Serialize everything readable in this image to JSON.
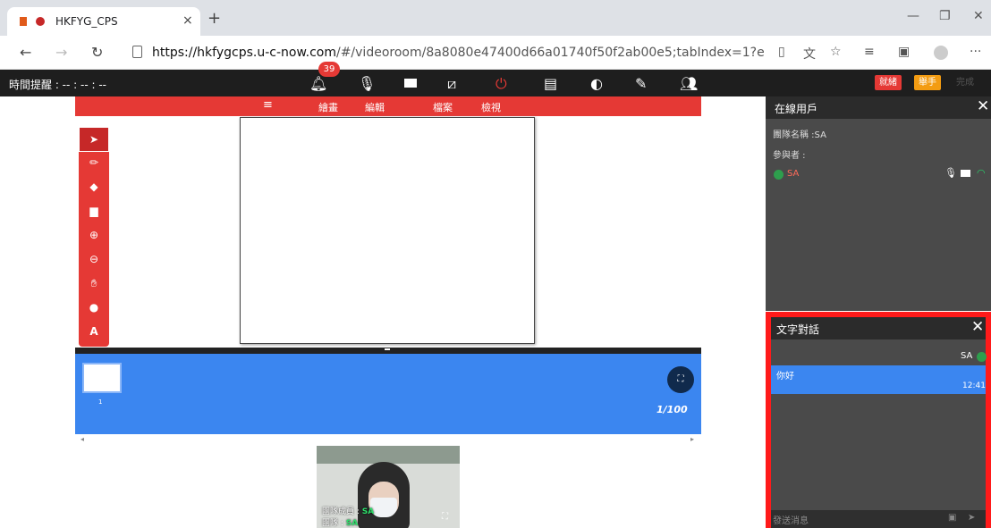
{
  "browser": {
    "tab_title": "HKFYG_CPS",
    "tab_close": "×",
    "new_tab": "+",
    "url_host": "https://hkfygcps.u-c-now.com",
    "url_path": "/#/videoroom/8a8080e47400d66a01740f50f2ab00e5;tabIndex=1?eventId=8a8...",
    "more": "···"
  },
  "toolbar": {
    "timer_label": "時間提醒 : -- : -- : --",
    "notification_count": "39",
    "ready_label": "就緒",
    "raise_hand_label": "舉手",
    "done_label": "完成",
    "colors": {
      "bar": "#1e1e1e",
      "power": "#e53935",
      "ready": "#e53935",
      "hand": "#f39c12"
    }
  },
  "whiteboard": {
    "menu": {
      "draw": "繪畫",
      "edit": "編輯",
      "file": "檔案",
      "view": "檢視"
    },
    "thumbnail_number": "1",
    "page_indicator": "1/100",
    "accent": "#e53935",
    "strip_color": "#3b86f0"
  },
  "video": {
    "member_label": "團隊成員 :",
    "member_name": "SA",
    "role_label": "團隊 :",
    "role_name": "SA"
  },
  "online_users": {
    "title": "在線用戶",
    "team_label": "團隊名稱 :SA",
    "participants_label": "參與者 :",
    "users": [
      {
        "name": "SA"
      }
    ]
  },
  "chat": {
    "title": "文字對話",
    "sender": "SA",
    "messages": [
      {
        "text": "你好",
        "time": "12:41"
      }
    ],
    "input_placeholder": "發送消息",
    "highlight_color": "#ff1a1a"
  }
}
